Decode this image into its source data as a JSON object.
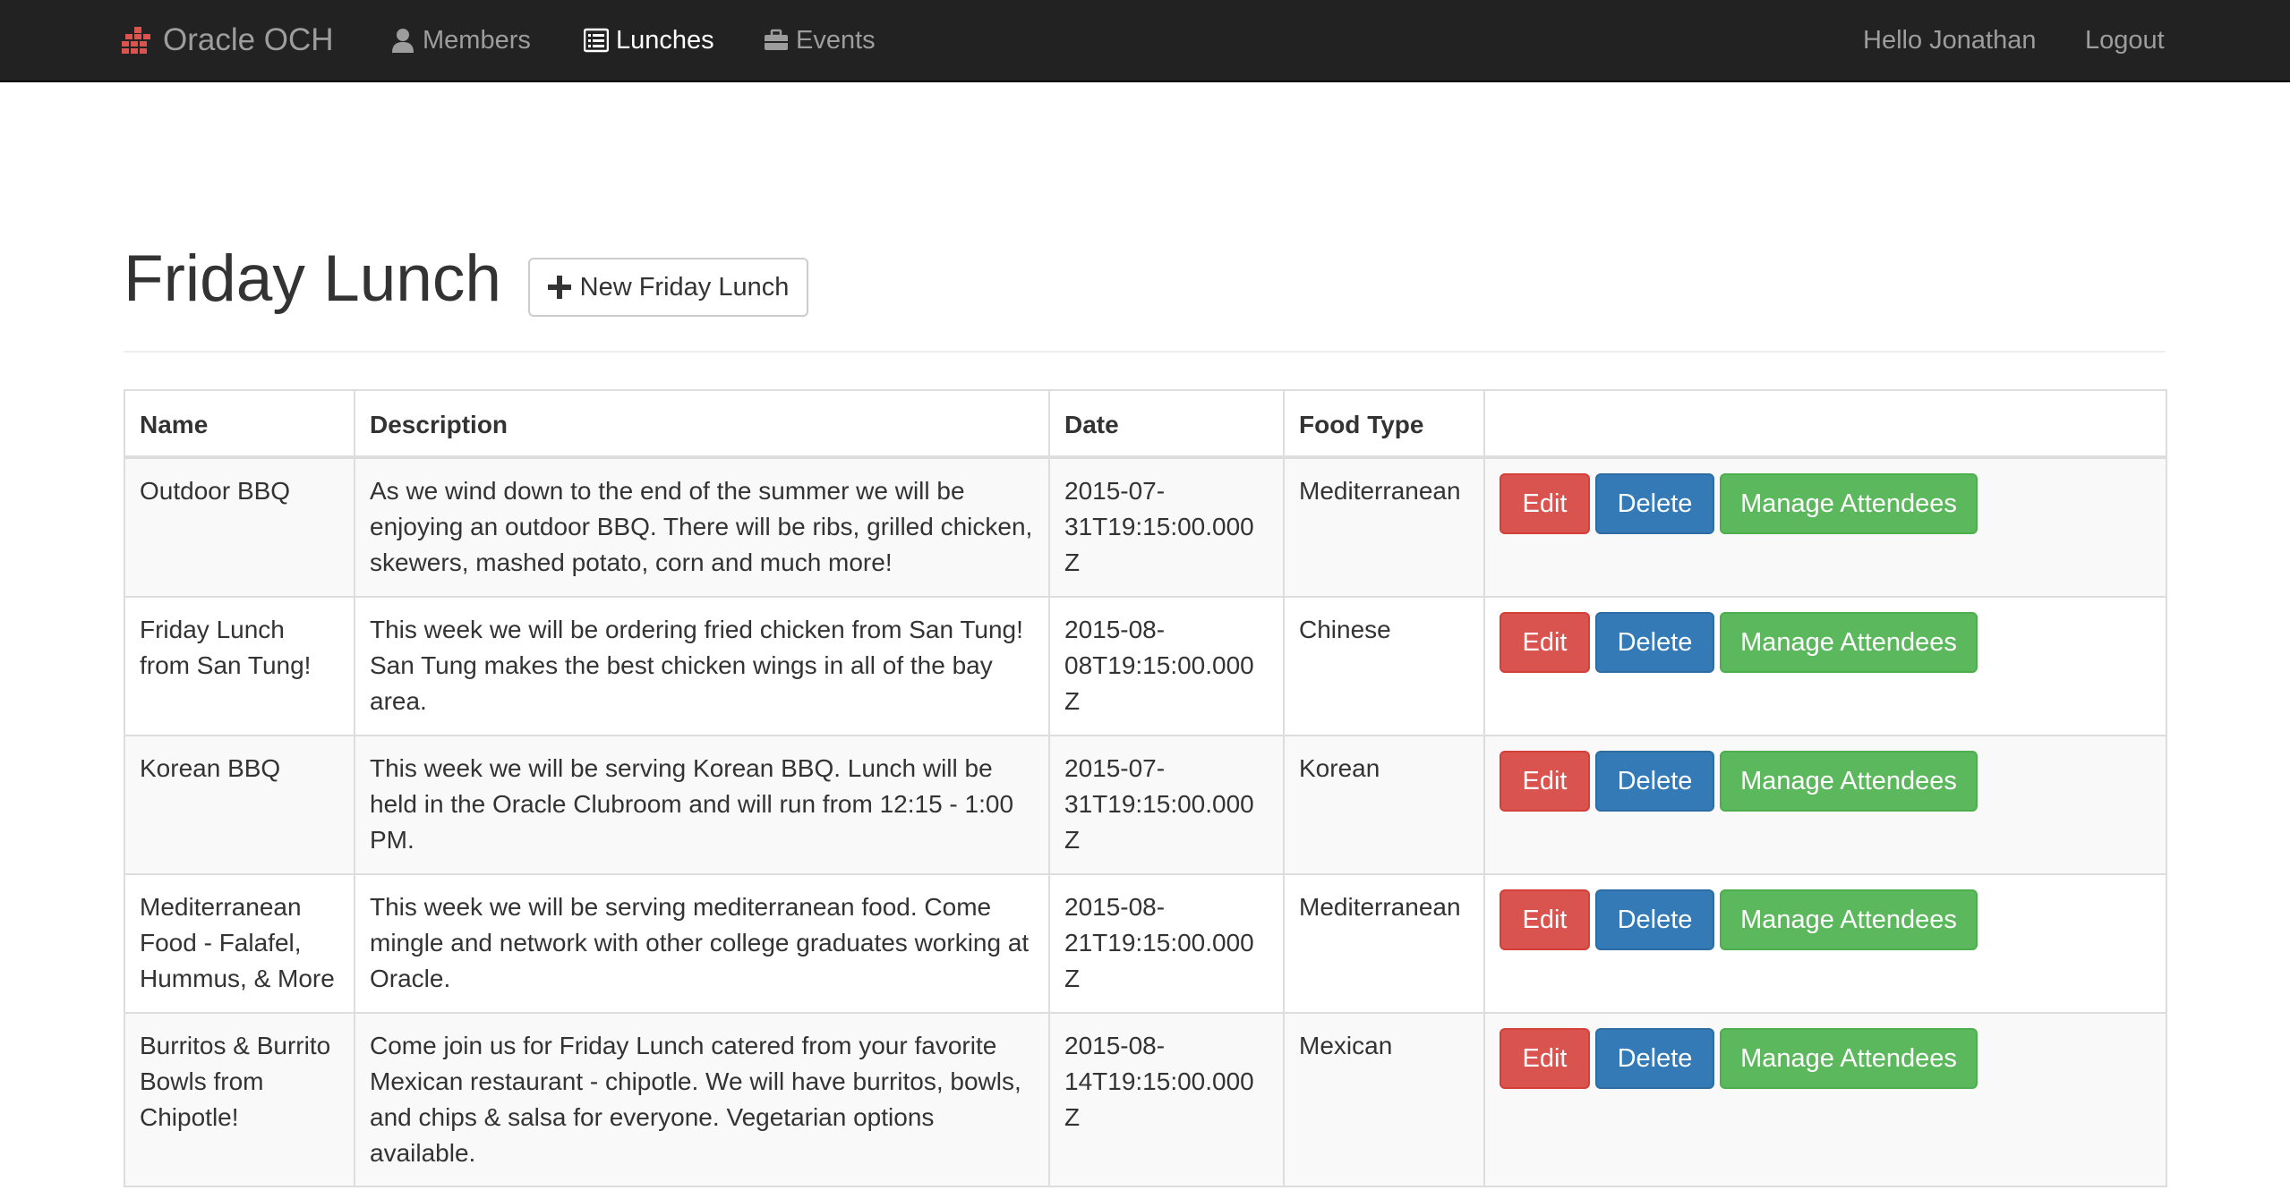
{
  "navbar": {
    "brand": "Oracle OCH",
    "links": [
      {
        "label": "Members",
        "icon": "user-icon"
      },
      {
        "label": "Lunches",
        "icon": "list-alt-icon",
        "active": true
      },
      {
        "label": "Events",
        "icon": "briefcase-icon"
      }
    ],
    "greeting": "Hello Jonathan",
    "logout": "Logout"
  },
  "header": {
    "title": "Friday Lunch",
    "new_button": "New Friday Lunch"
  },
  "table": {
    "columns": [
      "Name",
      "Description",
      "Date",
      "Food Type",
      ""
    ],
    "actions": {
      "edit": "Edit",
      "delete": "Delete",
      "manage": "Manage Attendees"
    },
    "rows": [
      {
        "name": "Outdoor BBQ",
        "description": "As we wind down to the end of the summer we will be enjoying an outdoor BBQ. There will be ribs, grilled chicken, skewers, mashed potato, corn and much more!",
        "date": "2015-07-31T19:15:00.000Z",
        "food_type": "Mediterranean"
      },
      {
        "name": "Friday Lunch from San Tung!",
        "description": "This week we will be ordering fried chicken from San Tung! San Tung makes the best chicken wings in all of the bay area.",
        "date": "2015-08-08T19:15:00.000Z",
        "food_type": "Chinese"
      },
      {
        "name": "Korean BBQ",
        "description": "This week we will be serving Korean BBQ. Lunch will be held in the Oracle Clubroom and will run from 12:15 - 1:00 PM.",
        "date": "2015-07-31T19:15:00.000Z",
        "food_type": "Korean"
      },
      {
        "name": "Mediterranean Food - Falafel, Hummus, & More",
        "description": "This week we will be serving mediterranean food. Come mingle and network with other college graduates working at Oracle.",
        "date": "2015-08-21T19:15:00.000Z",
        "food_type": "Mediterranean"
      },
      {
        "name": "Burritos & Burrito Bowls from Chipotle!",
        "description": "Come join us for Friday Lunch catered from your favorite Mexican restaurant - chipotle. We will have burritos, bowls, and chips & salsa for everyone. Vegetarian options available.",
        "date": "2015-08-14T19:15:00.000Z",
        "food_type": "Mexican"
      }
    ]
  },
  "colors": {
    "navbar_bg": "#222222",
    "brand_icon": "#d9534f",
    "edit": "#d9534f",
    "delete": "#337ab7",
    "manage": "#5cb85c"
  }
}
